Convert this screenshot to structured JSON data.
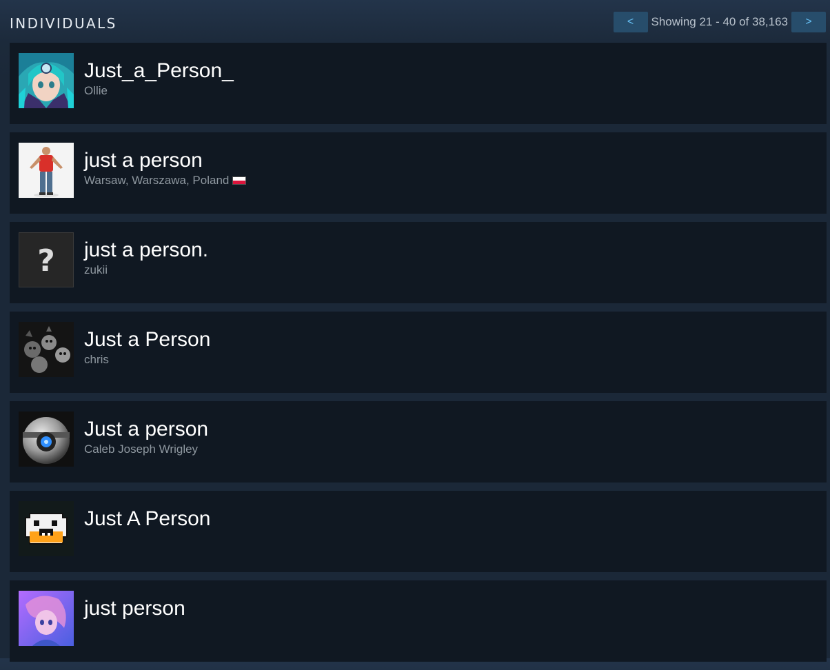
{
  "section_title": "INDIVIDUALS",
  "pager": {
    "prev_label": "<",
    "next_label": ">",
    "status": "Showing 21 - 40 of 38,163"
  },
  "results": [
    {
      "name": "Just_a_Person_",
      "subtitle": "Ollie",
      "avatar": "anime-teal-hair-avatar"
    },
    {
      "name": "just a person",
      "subtitle": "Warsaw, Warszawa, Poland",
      "flag": "poland-flag-icon",
      "avatar": "3d-man-red-shirt-avatar"
    },
    {
      "name": "just a person.",
      "subtitle": "zukii",
      "avatar": "question-mark-avatar"
    },
    {
      "name": "Just a Person",
      "subtitle": "chris",
      "avatar": "monochrome-teletubbies-avatar"
    },
    {
      "name": "Just a person",
      "subtitle": "Caleb Joseph Wrigley",
      "avatar": "wheatley-robot-avatar"
    },
    {
      "name": "Just A Person",
      "subtitle": "",
      "avatar": "pixel-creature-avatar"
    },
    {
      "name": "just person",
      "subtitle": "",
      "avatar": "purple-anime-avatar"
    }
  ],
  "colors": {
    "background": "#1b2838",
    "row_background": "#101822",
    "button_background": "#274d6b",
    "button_arrow": "#66c0f4",
    "subtitle_text": "#8f98a0"
  }
}
